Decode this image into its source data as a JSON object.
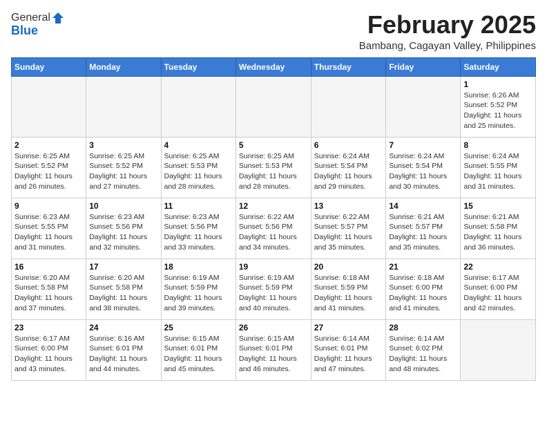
{
  "header": {
    "logo_general": "General",
    "logo_blue": "Blue",
    "title": "February 2025",
    "subtitle": "Bambang, Cagayan Valley, Philippines"
  },
  "days_of_week": [
    "Sunday",
    "Monday",
    "Tuesday",
    "Wednesday",
    "Thursday",
    "Friday",
    "Saturday"
  ],
  "weeks": [
    [
      {
        "day": "",
        "info": ""
      },
      {
        "day": "",
        "info": ""
      },
      {
        "day": "",
        "info": ""
      },
      {
        "day": "",
        "info": ""
      },
      {
        "day": "",
        "info": ""
      },
      {
        "day": "",
        "info": ""
      },
      {
        "day": "1",
        "info": "Sunrise: 6:26 AM\nSunset: 5:52 PM\nDaylight: 11 hours and 25 minutes."
      }
    ],
    [
      {
        "day": "2",
        "info": "Sunrise: 6:25 AM\nSunset: 5:52 PM\nDaylight: 11 hours and 26 minutes."
      },
      {
        "day": "3",
        "info": "Sunrise: 6:25 AM\nSunset: 5:52 PM\nDaylight: 11 hours and 27 minutes."
      },
      {
        "day": "4",
        "info": "Sunrise: 6:25 AM\nSunset: 5:53 PM\nDaylight: 11 hours and 28 minutes."
      },
      {
        "day": "5",
        "info": "Sunrise: 6:25 AM\nSunset: 5:53 PM\nDaylight: 11 hours and 28 minutes."
      },
      {
        "day": "6",
        "info": "Sunrise: 6:24 AM\nSunset: 5:54 PM\nDaylight: 11 hours and 29 minutes."
      },
      {
        "day": "7",
        "info": "Sunrise: 6:24 AM\nSunset: 5:54 PM\nDaylight: 11 hours and 30 minutes."
      },
      {
        "day": "8",
        "info": "Sunrise: 6:24 AM\nSunset: 5:55 PM\nDaylight: 11 hours and 31 minutes."
      }
    ],
    [
      {
        "day": "9",
        "info": "Sunrise: 6:23 AM\nSunset: 5:55 PM\nDaylight: 11 hours and 31 minutes."
      },
      {
        "day": "10",
        "info": "Sunrise: 6:23 AM\nSunset: 5:56 PM\nDaylight: 11 hours and 32 minutes."
      },
      {
        "day": "11",
        "info": "Sunrise: 6:23 AM\nSunset: 5:56 PM\nDaylight: 11 hours and 33 minutes."
      },
      {
        "day": "12",
        "info": "Sunrise: 6:22 AM\nSunset: 5:56 PM\nDaylight: 11 hours and 34 minutes."
      },
      {
        "day": "13",
        "info": "Sunrise: 6:22 AM\nSunset: 5:57 PM\nDaylight: 11 hours and 35 minutes."
      },
      {
        "day": "14",
        "info": "Sunrise: 6:21 AM\nSunset: 5:57 PM\nDaylight: 11 hours and 35 minutes."
      },
      {
        "day": "15",
        "info": "Sunrise: 6:21 AM\nSunset: 5:58 PM\nDaylight: 11 hours and 36 minutes."
      }
    ],
    [
      {
        "day": "16",
        "info": "Sunrise: 6:20 AM\nSunset: 5:58 PM\nDaylight: 11 hours and 37 minutes."
      },
      {
        "day": "17",
        "info": "Sunrise: 6:20 AM\nSunset: 5:58 PM\nDaylight: 11 hours and 38 minutes."
      },
      {
        "day": "18",
        "info": "Sunrise: 6:19 AM\nSunset: 5:59 PM\nDaylight: 11 hours and 39 minutes."
      },
      {
        "day": "19",
        "info": "Sunrise: 6:19 AM\nSunset: 5:59 PM\nDaylight: 11 hours and 40 minutes."
      },
      {
        "day": "20",
        "info": "Sunrise: 6:18 AM\nSunset: 5:59 PM\nDaylight: 11 hours and 41 minutes."
      },
      {
        "day": "21",
        "info": "Sunrise: 6:18 AM\nSunset: 6:00 PM\nDaylight: 11 hours and 41 minutes."
      },
      {
        "day": "22",
        "info": "Sunrise: 6:17 AM\nSunset: 6:00 PM\nDaylight: 11 hours and 42 minutes."
      }
    ],
    [
      {
        "day": "23",
        "info": "Sunrise: 6:17 AM\nSunset: 6:00 PM\nDaylight: 11 hours and 43 minutes."
      },
      {
        "day": "24",
        "info": "Sunrise: 6:16 AM\nSunset: 6:01 PM\nDaylight: 11 hours and 44 minutes."
      },
      {
        "day": "25",
        "info": "Sunrise: 6:15 AM\nSunset: 6:01 PM\nDaylight: 11 hours and 45 minutes."
      },
      {
        "day": "26",
        "info": "Sunrise: 6:15 AM\nSunset: 6:01 PM\nDaylight: 11 hours and 46 minutes."
      },
      {
        "day": "27",
        "info": "Sunrise: 6:14 AM\nSunset: 6:01 PM\nDaylight: 11 hours and 47 minutes."
      },
      {
        "day": "28",
        "info": "Sunrise: 6:14 AM\nSunset: 6:02 PM\nDaylight: 11 hours and 48 minutes."
      },
      {
        "day": "",
        "info": ""
      }
    ]
  ]
}
